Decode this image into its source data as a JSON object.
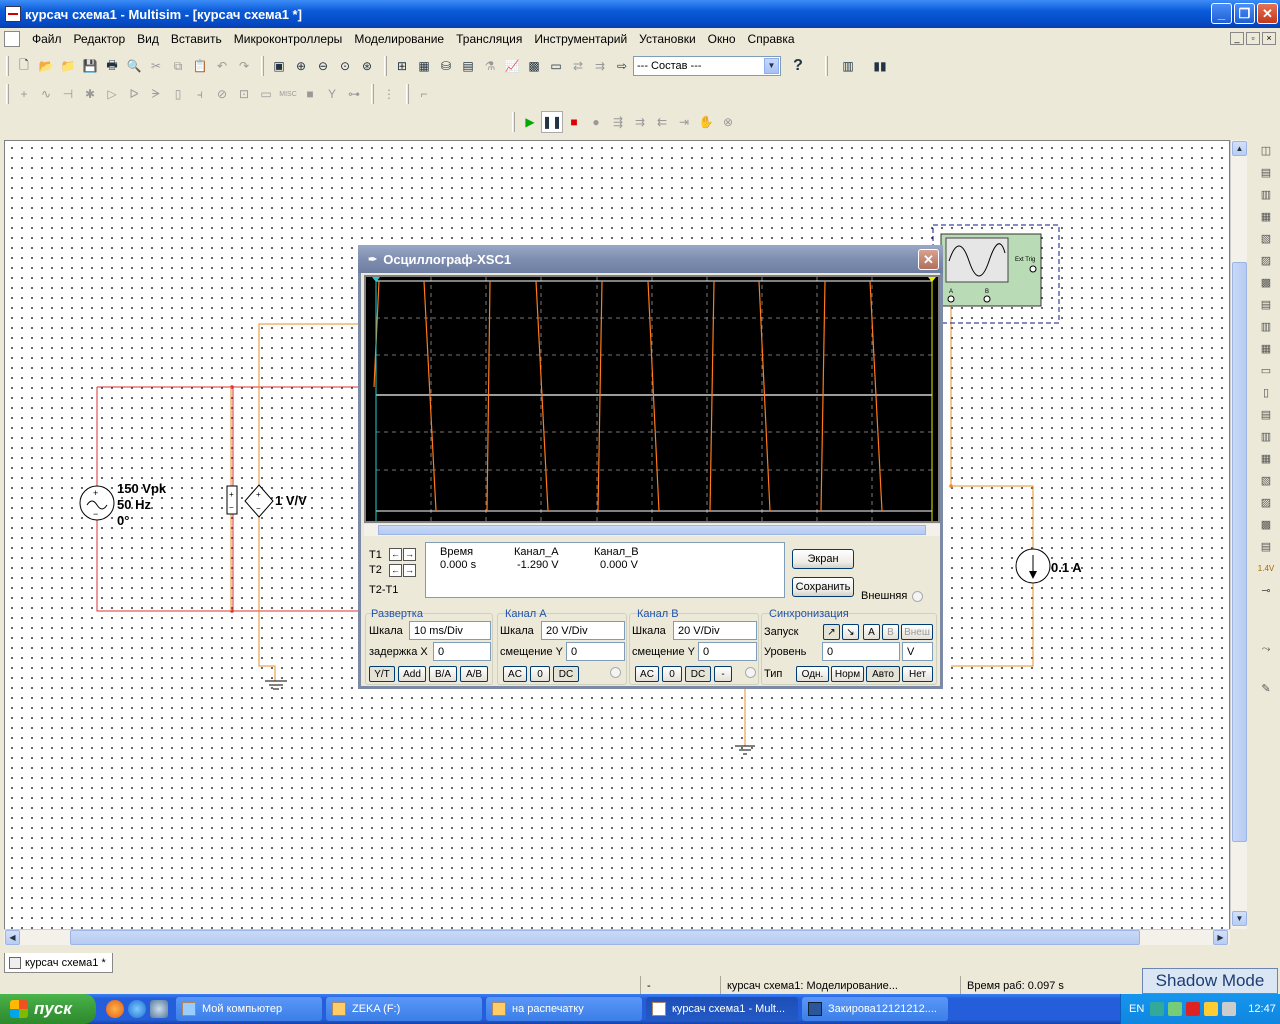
{
  "window": {
    "title": "курсач схема1 - Multisim - [курсач схема1 *]"
  },
  "menu": [
    "Файл",
    "Редактор",
    "Вид",
    "Вставить",
    "Микроконтроллеры",
    "Моделирование",
    "Трансляция",
    "Инструментарий",
    "Установки",
    "Окно",
    "Справка"
  ],
  "toolbar": {
    "usage_combo": "--- Состав ---",
    "help_glyph": "?"
  },
  "circuit": {
    "source_amplitude": "150 Vpk",
    "source_freq": "50 Hz",
    "source_phase": "0°",
    "vcvs_gain": "1 V/V",
    "current_source": "0.1 A",
    "scope_ext_trig": "Ext Trig",
    "scope_a": "A",
    "scope_b": "B"
  },
  "scope": {
    "title": "Осциллограф-XSC1",
    "t1": "T1",
    "t2": "T2",
    "t2t1": "T2-T1",
    "readout_headers": [
      "Время",
      "Канал_A",
      "Канал_B"
    ],
    "readout_values": [
      "0.000 s",
      "-1.290 V",
      "0.000 V"
    ],
    "btn_screen": "Экран",
    "btn_save": "Сохранить",
    "external_label": "Внешняя",
    "timebase": {
      "title": "Развертка",
      "scale_label": "Шкала",
      "scale": "10 ms/Div",
      "delay_label": "задержка X",
      "delay": "0",
      "modes": [
        "Y/T",
        "Add",
        "B/A",
        "A/B"
      ]
    },
    "channel_a": {
      "title": "Канал А",
      "scale_label": "Шкала",
      "scale": "20  V/Div",
      "offset_label": "смещение Y",
      "offset": "0",
      "coupling": [
        "AC",
        "0",
        "DC"
      ]
    },
    "channel_b": {
      "title": "Канал В",
      "scale_label": "Шкала",
      "scale": "20  V/Div",
      "offset_label": "смещение Y",
      "offset": "0",
      "coupling": [
        "AC",
        "0",
        "DC",
        "-"
      ]
    },
    "trigger": {
      "title": "Синхронизация",
      "edge_label": "Запуск",
      "sources": [
        "A",
        "B",
        "Внеш"
      ],
      "level_label": "Уровень",
      "level": "0",
      "level_unit": "V",
      "type_label": "Тип",
      "types": [
        "Одн.",
        "Норм",
        "Авто",
        "Нет"
      ]
    }
  },
  "sheet_tab": "курсач схема1 *",
  "status": {
    "cell1": "-",
    "cell2": "курсач схема1: Моделирование...",
    "cell3": "Время раб: 0.097 s"
  },
  "shadow_mode": "Shadow Mode",
  "taskbar": {
    "start": "пуск",
    "tasks": [
      "Мой компьютер",
      "ZEKA (F:)",
      "на распечатку",
      "курсач схема1 - Mult...",
      "Закирова12121212...."
    ],
    "lang": "EN",
    "clock": "12:47"
  }
}
